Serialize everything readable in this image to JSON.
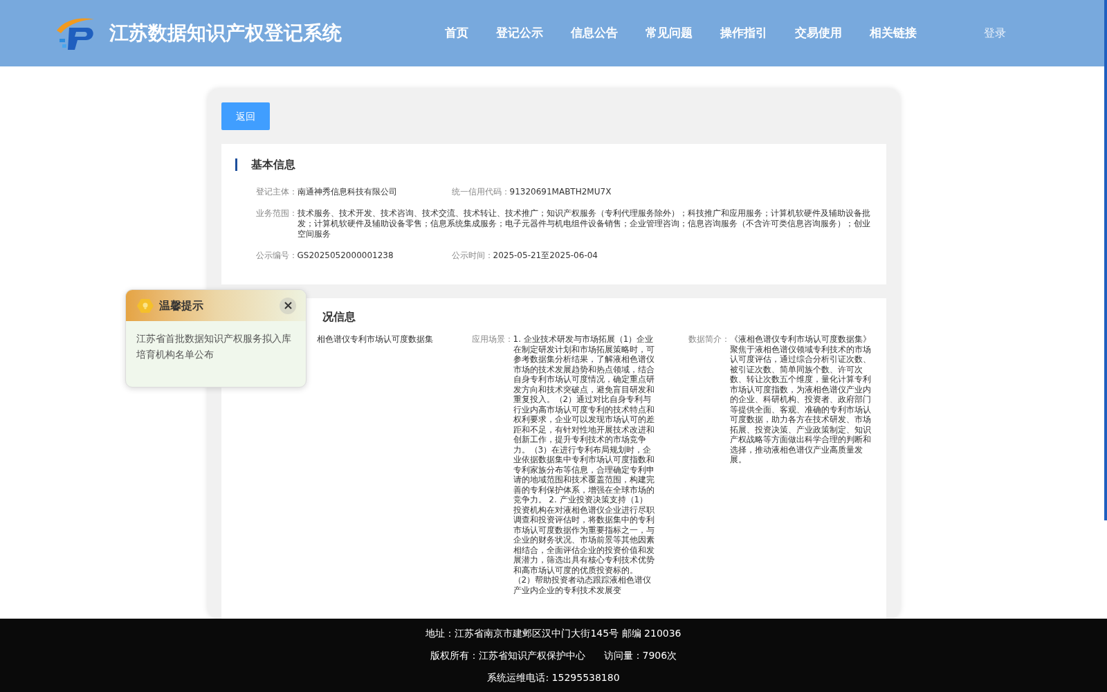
{
  "header": {
    "site_title": "江苏数据知识产权登记系统",
    "nav": [
      {
        "label": "首页"
      },
      {
        "label": "登记公示"
      },
      {
        "label": "信息公告"
      },
      {
        "label": "常见问题"
      },
      {
        "label": "操作指引"
      },
      {
        "label": "交易使用"
      },
      {
        "label": "相关链接"
      }
    ],
    "login": "登录"
  },
  "back_button": "返回",
  "basic_info": {
    "title": "基本信息",
    "rows": [
      [
        {
          "label": "登记主体：",
          "value": "南通神秀信息科技有限公司"
        },
        {
          "label": "统一信用代码：",
          "value": "91320691MABTH2MU7X"
        }
      ],
      [
        {
          "label": "业务范围：",
          "value": "技术服务、技术开发、技术咨询、技术交流、技术转让、技术推广；知识产权服务（专利代理服务除外）；科技推广和应用服务；计算机软硬件及辅助设备批发；计算机软硬件及辅助设备零售；信息系统集成服务；电子元器件与机电组件设备销售；企业管理咨询；信息咨询服务（不含许可类信息咨询服务）；创业空间服务"
        }
      ],
      [
        {
          "label": "公示编号：",
          "value": "GS2025052000001238"
        },
        {
          "label": "公示时间：",
          "value": "2025-05-21至2025-06-04"
        }
      ]
    ]
  },
  "registration_info": {
    "title": "况信息",
    "dataset_name": "相色谱仪专利市场认可度数据集",
    "fields": [
      {
        "label": "应用场景：",
        "value": "1. 企业技术研发与市场拓展（1）企业在制定研发计划和市场拓展策略时，可参考数据集分析结果，了解液相色谱仪市场的技术发展趋势和热点领域，结合自身专利市场认可度情况，确定重点研发方向和技术突破点，避免盲目研发和重复投入。（2）通过对比自身专利与行业内高市场认可度专利的技术特点和权利要求，企业可以发现市场认可的差距和不足，有针对性地开展技术改进和创新工作，提升专利技术的市场竞争力。（3）在进行专利布局规划时，企业依据数据集中专利市场认可度指数和专利家族分布等信息，合理确定专利申请的地域范围和技术覆盖范围，构建完善的专利保护体系，增强在全球市场的竞争力。 2. 产业投资决策支持（1）投资机构在对液相色谱仪企业进行尽职调查和投资评估时，将数据集中的专利市场认可度数据作为重要指标之一，与企业的财务状况、市场前景等其他因素相结合，全面评估企业的投资价值和发展潜力，筛选出具有核心专利技术优势和高市场认可度的优质投资标的。（2）帮助投资者动态跟踪液相色谱仪产业内企业的专利技术发展变"
      },
      {
        "label": "数据简介：",
        "value": "《液相色谱仪专利市场认可度数据集》聚焦于液相色谱仪领域专利技术的市场认可度评估，通过综合分析引证次数、被引证次数、简单同族个数、许可次数、转让次数五个维度，量化计算专利市场认可度指数，为液相色谱仪产业内的企业、科研机构、投资者、政府部门等提供全面、客观、准确的专利市场认可度数据，助力各方在技术研发、市场拓展、投资决策、产业政策制定、知识产权战略等方面做出科学合理的判断和选择，推动液相色谱仪产业高质量发展。"
      }
    ]
  },
  "notice_popup": {
    "title": "温馨提示",
    "message": "江苏省首批数据知识产权服务拟入库培育机构名单公布"
  },
  "footer": {
    "lines": [
      "地址：江苏省南京市建邺区汉中门大街145号 邮编 210036",
      "版权所有：江苏省知识产权保护中心      访问量：7906次",
      "系统运维电话: 15295538180"
    ]
  }
}
